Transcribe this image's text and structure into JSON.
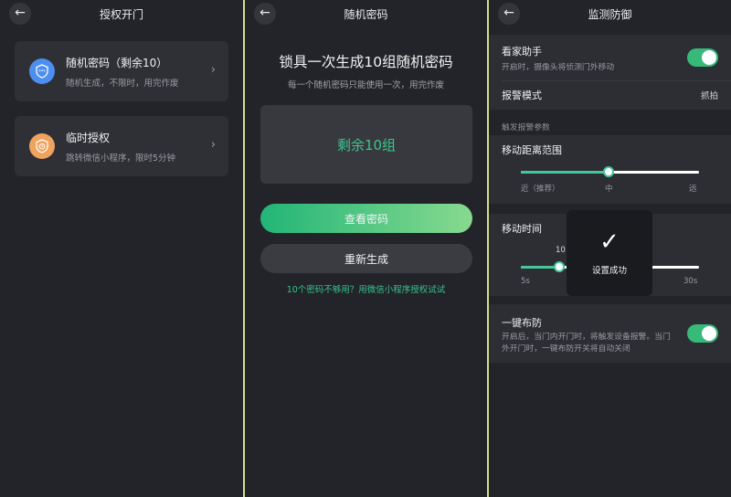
{
  "colors": {
    "accent": "#37b97a",
    "background": "#232429",
    "card": "#2f3036"
  },
  "screen1": {
    "title": "授权开门",
    "back_icon": "arrow-left-icon",
    "cards": [
      {
        "title": "随机密码（剩余10）",
        "subtitle": "随机生成，不限时，用完作废",
        "icon": "shield-password-icon",
        "icon_color": "#4d8ff0"
      },
      {
        "title": "临时授权",
        "subtitle": "跳转微信小程序，限时5分钟",
        "icon": "shield-clock-icon",
        "icon_color": "#f0a35c"
      }
    ]
  },
  "screen2": {
    "title": "随机密码",
    "heading": "锁具一次生成10组随机密码",
    "subheading": "每一个随机密码只能使用一次，用完作废",
    "remaining": "剩余10组",
    "view_button": "查看密码",
    "regen_button": "重新生成",
    "link": "10个密码不够用？用微信小程序授权试试"
  },
  "screen3": {
    "title": "监测防御",
    "guard": {
      "title": "看家助手",
      "subtitle": "开启时，摄像头将侦测门外移动",
      "enabled": true
    },
    "alarm_mode": {
      "label": "报警模式",
      "value": "抓拍"
    },
    "group_label": "触发报警参数",
    "distance": {
      "label": "移动距离范围",
      "ticks": [
        "近（推荐）",
        "中",
        "远"
      ],
      "level": 0.5
    },
    "time": {
      "label": "移动时间",
      "value_label": "10",
      "min": "5s",
      "max": "30s",
      "level": 0.2
    },
    "one_key": {
      "title": "一键布防",
      "subtitle_line1": "开启后，当门内开门时，将触发设备报警。当门",
      "subtitle_line2": "外开门时，一键布防开关将自动关闭",
      "enabled": true
    }
  },
  "toast": {
    "icon": "check-icon",
    "message": "设置成功"
  }
}
